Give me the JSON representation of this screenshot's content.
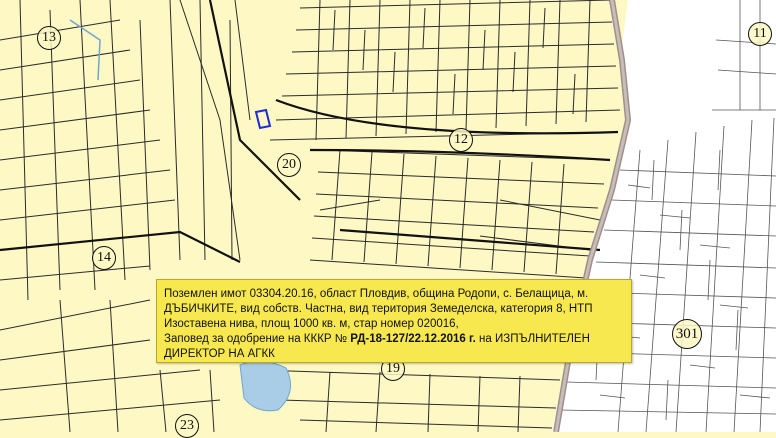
{
  "colors": {
    "agricultural": "#fdf8c4",
    "urban": "#ffffff",
    "parcel_lines": "#2b2b2b",
    "road_edge": "#9e8f8a",
    "water": "#a9cde6",
    "selected_parcel": "#1a2bd6",
    "info_box": "#f7e84f"
  },
  "area_labels": [
    "13",
    "11",
    "12",
    "20",
    "14",
    "301",
    "19",
    "23"
  ],
  "info": {
    "line1": "Поземлен имот 03304.20.16, област Пловдив, община Родопи, с. Белащица, м.",
    "line2": "ДЪБИЧКИТЕ, вид собств. Частна, вид територия Земеделска, категория 8, НТП",
    "line3": "Изоставена нива, площ 1000 кв. м, стар номер 020016,",
    "line4_prefix": "Заповед за одобрение на КККР № ",
    "line4_order": "РД-18-127/22.12.2016 г.",
    "line4_suffix": " на ИЗПЪЛНИТЕЛЕН",
    "line5": "ДИРЕКТОР НА АГКК"
  }
}
